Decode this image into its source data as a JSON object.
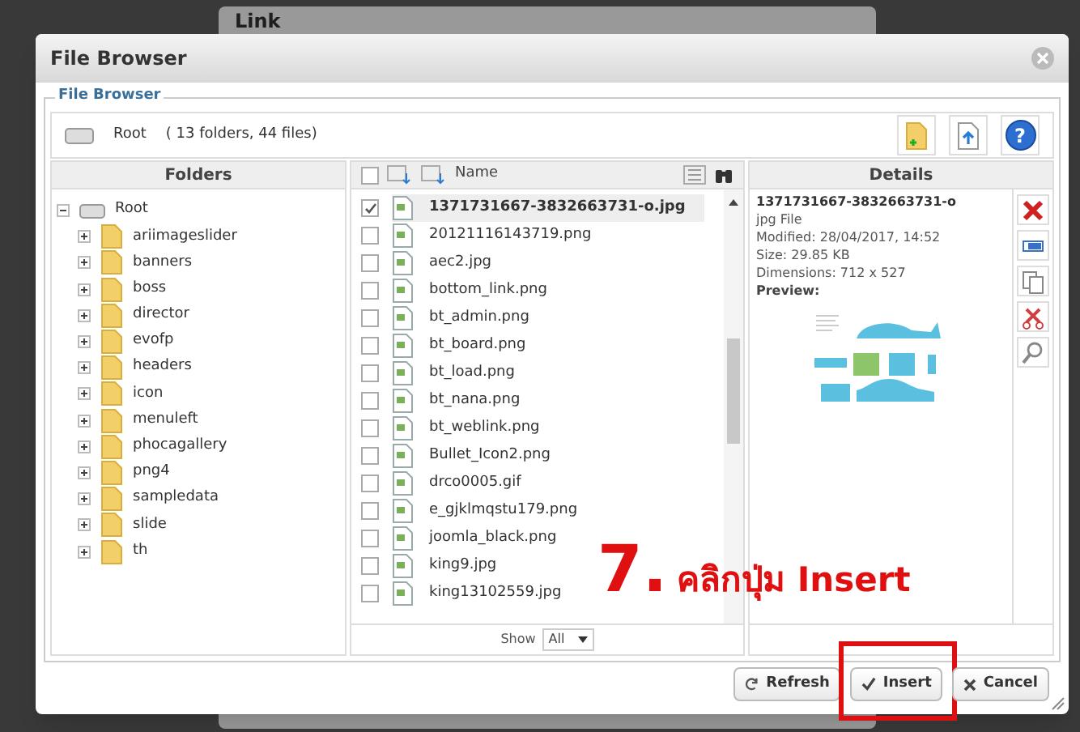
{
  "background_dialog": {
    "title": "Link"
  },
  "window": {
    "title": "File Browser"
  },
  "fieldset_legend": "File Browser",
  "location": {
    "name": "Root",
    "summary": "( 13 folders, 44 files)"
  },
  "help_button": "?",
  "folders": {
    "header": "Folders",
    "tree": [
      {
        "label": "Root",
        "expanded": true,
        "children": [
          {
            "label": "ariimageslider",
            "expanded": false
          },
          {
            "label": "banners",
            "expanded": false
          },
          {
            "label": "boss",
            "expanded": false
          },
          {
            "label": "director",
            "expanded": false
          },
          {
            "label": "evofp",
            "expanded": false
          },
          {
            "label": "headers",
            "expanded": false
          },
          {
            "label": "icon",
            "expanded": false
          },
          {
            "label": "menuleft",
            "expanded": false
          },
          {
            "label": "phocagallery",
            "expanded": false
          },
          {
            "label": "png4",
            "expanded": false
          },
          {
            "label": "sampledata",
            "expanded": false
          },
          {
            "label": "slide",
            "expanded": false
          },
          {
            "label": "th",
            "expanded": false
          }
        ]
      }
    ]
  },
  "files": {
    "header": "Name",
    "select_all": false,
    "show_label": "Show",
    "show_value": "All",
    "rows": [
      {
        "name": "1371731667-3832663731-o.jpg",
        "selected": true
      },
      {
        "name": "20121116143719.png",
        "selected": false
      },
      {
        "name": "aec2.jpg",
        "selected": false
      },
      {
        "name": "bottom_link.png",
        "selected": false
      },
      {
        "name": "bt_admin.png",
        "selected": false
      },
      {
        "name": "bt_board.png",
        "selected": false
      },
      {
        "name": "bt_load.png",
        "selected": false
      },
      {
        "name": "bt_nana.png",
        "selected": false
      },
      {
        "name": "bt_weblink.png",
        "selected": false
      },
      {
        "name": "Bullet_Icon2.png",
        "selected": false
      },
      {
        "name": "drco0005.gif",
        "selected": false
      },
      {
        "name": "e_gjklmqstu179.png",
        "selected": false
      },
      {
        "name": "joomla_black.png",
        "selected": false
      },
      {
        "name": "king9.jpg",
        "selected": false
      },
      {
        "name": "king13102559.jpg",
        "selected": false
      }
    ]
  },
  "details": {
    "header": "Details",
    "name": "1371731667-3832663731-o",
    "type": "jpg File",
    "modified": "Modified: 28/04/2017, 14:52",
    "size": "Size: 29.85 KB",
    "dimensions": "Dimensions: 712 x 527",
    "preview_label": "Preview:"
  },
  "buttons": [
    {
      "label": "Refresh",
      "kind": "refresh"
    },
    {
      "label": "Insert",
      "kind": "insert",
      "highlighted": true
    },
    {
      "label": "Cancel",
      "kind": "cancel"
    }
  ],
  "annotation": {
    "number": "7.",
    "text": "คลิกปุ่ม Insert"
  }
}
